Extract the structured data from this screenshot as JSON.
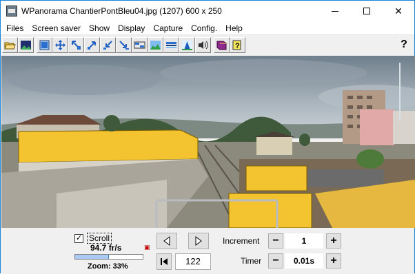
{
  "window": {
    "title": "WPanorama  ChantierPontBleu04.jpg  (1207) 600 x 250",
    "controls": {
      "minimize": "minimize",
      "maximize": "maximize",
      "close": "✕"
    }
  },
  "menu": [
    {
      "label": "Files"
    },
    {
      "label": "Screen saver"
    },
    {
      "label": "Show"
    },
    {
      "label": "Display"
    },
    {
      "label": "Capture"
    },
    {
      "label": "Config."
    },
    {
      "label": "Help"
    }
  ],
  "toolbar": {
    "buttons": [
      "open-file-icon",
      "picture-icon",
      "fit-window-icon",
      "move-arrows-icon",
      "zoom-out-arrow-icon",
      "zoom-in-arrow-icon",
      "shrink-arrow-icon",
      "expand-arrow-icon",
      "sequence-icon",
      "landscape-icon",
      "flat-view-icon",
      "landscape-shadow-icon",
      "sound-icon",
      "book-icon",
      "help-book-icon"
    ],
    "help_label": "?"
  },
  "panorama": {
    "alt": "Panoramic photo of a construction site beside railway tracks"
  },
  "scroll": {
    "checkbox_label": "Scroll",
    "checked": true,
    "speed": "94.7 fr/s",
    "speed_level": 0.5,
    "zoom": "Zoom: 33%"
  },
  "navigation": {
    "left_icon": "play-left-icon",
    "right_icon": "play-right-icon",
    "first_icon": "skip-to-start-icon",
    "position": "122"
  },
  "increment": {
    "label": "Increment",
    "value": "1",
    "minus": "−",
    "plus": "+"
  },
  "timer": {
    "label": "Timer",
    "value": "0.01s",
    "minus": "−",
    "plus": "+"
  },
  "colors": {
    "accent": "#1883d7",
    "sky": "#8a9aa6",
    "hoarding_yellow": "#f4c430"
  }
}
